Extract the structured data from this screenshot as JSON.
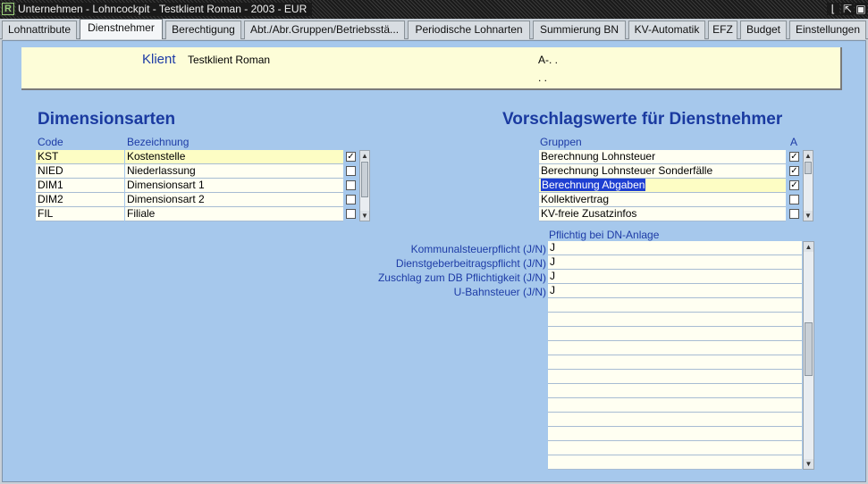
{
  "window": {
    "title": "Unternehmen - Lohncockpit - Testklient Roman - 2003 - EUR",
    "app_icon_glyph": "R",
    "minimize_glyph": "⌊",
    "restore_glyph": "⇱",
    "close_glyph": "▣"
  },
  "tabs": [
    {
      "label": "Lohnattribute",
      "active": false
    },
    {
      "label": "Dienstnehmer",
      "active": true
    },
    {
      "label": "Berechtigung",
      "active": false
    },
    {
      "label": "Abt./Abr.Gruppen/Betriebsstä...",
      "active": false
    },
    {
      "label": "Periodische Lohnarten",
      "active": false
    },
    {
      "label": "Summierung BN",
      "active": false
    },
    {
      "label": "KV-Automatik",
      "active": false
    },
    {
      "label": "EFZ",
      "active": false
    },
    {
      "label": "Budget",
      "active": false
    },
    {
      "label": "Einstellungen",
      "active": false
    }
  ],
  "klient": {
    "label": "Klient",
    "name": "Testklient Roman",
    "code": "A-. .",
    "dots": ". ."
  },
  "dimensionsarten": {
    "title": "Dimensionsarten",
    "col_code": "Code",
    "col_bezeichnung": "Bezeichnung",
    "rows": [
      {
        "code": "KST",
        "bezeichnung": "Kostenstelle",
        "checked": true
      },
      {
        "code": "NIED",
        "bezeichnung": "Niederlassung",
        "checked": false
      },
      {
        "code": "DIM1",
        "bezeichnung": "Dimensionsart 1",
        "checked": false
      },
      {
        "code": "DIM2",
        "bezeichnung": "Dimensionsart 2",
        "checked": false
      },
      {
        "code": "FIL",
        "bezeichnung": "Filiale",
        "checked": false
      }
    ]
  },
  "vorschlagswerte": {
    "title": "Vorschlagswerte für Dienstnehmer",
    "col_gruppen": "Gruppen",
    "col_a": "A",
    "rows": [
      {
        "label": "Berechnung Lohnsteuer",
        "checked": true
      },
      {
        "label": "Berechnung Lohnsteuer Sonderfälle",
        "checked": true
      },
      {
        "label": "Berechnung Abgaben",
        "checked": true
      },
      {
        "label": "Kollektivertrag",
        "checked": false
      },
      {
        "label": "KV-freie Zusatzinfos",
        "checked": false
      }
    ]
  },
  "pflichtig": {
    "heading": "Pflichtig bei DN-Anlage",
    "rows": [
      {
        "label": "Kommunalsteuerpflicht (J/N)",
        "value": "J"
      },
      {
        "label": "Dienstgeberbeitragspflicht (J/N)",
        "value": "J"
      },
      {
        "label": "Zuschlag zum DB Pflichtigkeit (J/N)",
        "value": "J"
      },
      {
        "label": "U-Bahnsteuer (J/N)",
        "value": "J"
      },
      {
        "label": "",
        "value": ""
      },
      {
        "label": "",
        "value": ""
      },
      {
        "label": "",
        "value": ""
      },
      {
        "label": "",
        "value": ""
      },
      {
        "label": "",
        "value": ""
      },
      {
        "label": "",
        "value": ""
      },
      {
        "label": "",
        "value": ""
      },
      {
        "label": "",
        "value": ""
      },
      {
        "label": "",
        "value": ""
      },
      {
        "label": "",
        "value": ""
      },
      {
        "label": "",
        "value": ""
      },
      {
        "label": "",
        "value": ""
      }
    ]
  },
  "colors": {
    "panel_bg": "#a6c8ec",
    "title_blue": "#1a3aa0",
    "selection": "#1e3fd2",
    "cell_bg": "#fffff2"
  }
}
